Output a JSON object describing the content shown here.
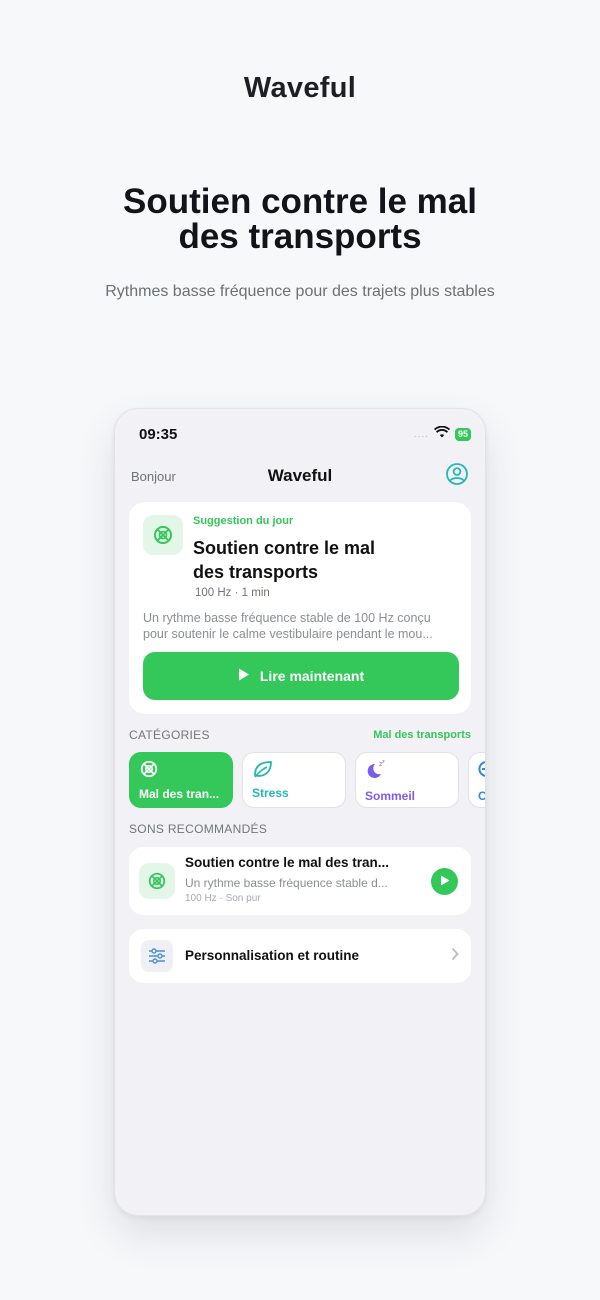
{
  "hero": {
    "brand": "Waveful",
    "headline_line1": "Soutien contre le mal",
    "headline_line2": "des transports",
    "subline": "Rythmes basse fréquence pour des trajets plus stables"
  },
  "status_bar": {
    "time": "09:35",
    "signal": "....",
    "battery": "95"
  },
  "nav": {
    "greeting": "Bonjour",
    "title": "Waveful",
    "profile_icon": "person-circle-icon"
  },
  "suggestion": {
    "label": "Suggestion du jour",
    "title_line1": "Soutien contre le mal",
    "title_line2": "des transports",
    "meta": "100 Hz · 1 min",
    "desc_line1": "Un rythme basse fréquence stable de 100 Hz conçu",
    "desc_line2": "pour soutenir le calme vestibulaire pendant le mou...",
    "button_label": "Lire maintenant",
    "icon": "compass-cross-icon"
  },
  "categories": {
    "title": "CATÉGORIES",
    "selected": "Mal des transports",
    "items": [
      {
        "label": "Mal des tran...",
        "icon": "compass-cross-icon",
        "color": "#34c759"
      },
      {
        "label": "Stress",
        "icon": "leaf-icon",
        "color": "#23b7b7"
      },
      {
        "label": "Sommeil",
        "icon": "moon-zzz-icon",
        "color": "#7b5cf0"
      },
      {
        "label": "C",
        "icon": "arrows-icon",
        "color": "#2f8ad9"
      }
    ]
  },
  "recommended": {
    "title": "SONS RECOMMANDÉS",
    "items": [
      {
        "title": "Soutien contre le mal des tran...",
        "subtitle": "Un rythme basse fréquence stable d...",
        "meta": "100 Hz · Son pur",
        "icon": "compass-cross-icon"
      }
    ]
  },
  "personalization": {
    "label": "Personnalisation et routine",
    "icon": "sliders-icon"
  },
  "colors": {
    "accent": "#34c759",
    "background": "#f1f1f6",
    "card": "#ffffff"
  }
}
